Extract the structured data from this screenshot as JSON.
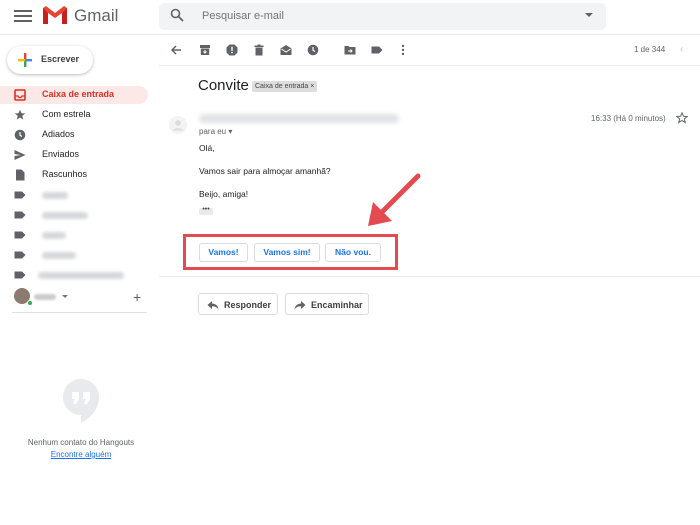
{
  "app": {
    "name": "Gmail"
  },
  "search": {
    "placeholder": "Pesquisar e-mail"
  },
  "compose": {
    "label": "Escrever"
  },
  "sidebar": {
    "items": [
      {
        "label": "Caixa de entrada",
        "icon": "inbox-icon",
        "active": true
      },
      {
        "label": "Com estrela",
        "icon": "star-icon"
      },
      {
        "label": "Adiados",
        "icon": "clock-icon"
      },
      {
        "label": "Enviados",
        "icon": "send-icon"
      },
      {
        "label": "Rascunhos",
        "icon": "draft-icon"
      }
    ]
  },
  "hangouts": {
    "empty_text": "Nenhum contato do Hangouts",
    "link": "Encontre alguém"
  },
  "toolbar": {
    "page_count": "1 de 344"
  },
  "message": {
    "subject": "Convite",
    "label": "Caixa de entrada",
    "label_close": "×",
    "to": "para eu",
    "time": "16:33 (Há 0 minutos)",
    "body": [
      "Olá,",
      "Vamos sair para almoçar amanhã?",
      "Beijo, amiga!"
    ],
    "ellipsis": "•••"
  },
  "smart_replies": [
    "Vamos!",
    "Vamos sim!",
    "Não vou."
  ],
  "actions": {
    "reply": "Responder",
    "forward": "Encaminhar"
  },
  "colors": {
    "accent": "#d93025",
    "highlight": "#e34b50",
    "link": "#1a73e8"
  }
}
